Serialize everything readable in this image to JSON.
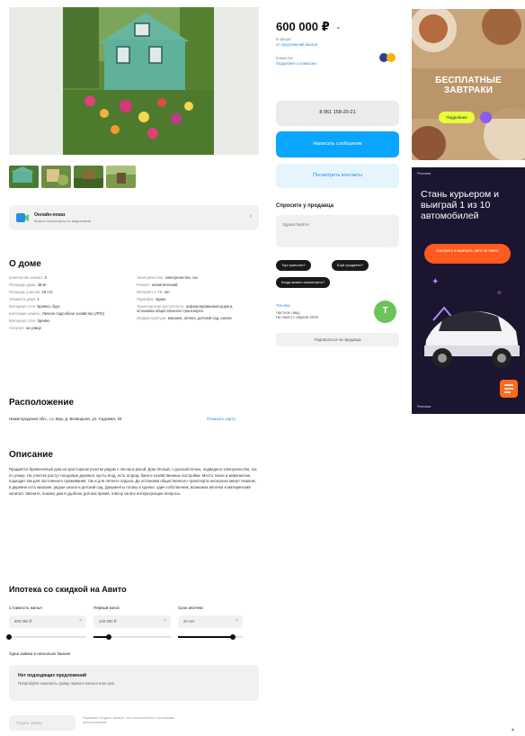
{
  "listing": {
    "price": "600 000 ₽",
    "price_chevron": "⌄",
    "price_history": "В кредит",
    "price_link": "от предложений банков",
    "payment_title": "Комиссия",
    "payment_link": "Подробнее о комиссии"
  },
  "contacts": {
    "phone": "8 961 158-20-21",
    "write_label": "Написать сообщение",
    "show_label": "Посмотреть контакты"
  },
  "delivery": {
    "title": "Онлайн-показ",
    "subtitle": "Можно посмотреть по видеосвязи",
    "chevron": "›"
  },
  "sections": {
    "about_house": "О доме",
    "location": "Расположение",
    "description": "Описание",
    "mortgage": "Ипотека со скидкой на Авито"
  },
  "params_left": [
    {
      "k": "Количество комнат: ",
      "v": "3"
    },
    {
      "k": "Площадь дома: ",
      "v": "48 м²"
    },
    {
      "k": "Площадь участка: ",
      "v": "15 сот."
    },
    {
      "k": "Этажей в доме: ",
      "v": "1"
    },
    {
      "k": "Материал стен: ",
      "v": "Бревно, брус"
    },
    {
      "k": "Категория земель: ",
      "v": "Личное подсобное хозяйство (ЛПХ)"
    },
    {
      "k": "Материал стен: ",
      "v": "бревно"
    },
    {
      "k": "Санузел: ",
      "v": "на улице"
    }
  ],
  "params_right": [
    {
      "k": "Электричество: ",
      "v": "электричество, газ"
    },
    {
      "k": "Ремонт: ",
      "v": "косметический"
    },
    {
      "k": "Интернет и ТВ: ",
      "v": "нет"
    },
    {
      "k": "Парковка: ",
      "v": "гараж"
    },
    {
      "k": "Транспортная доступность: ",
      "v": "асфальтированная дорога, остановка общественного транспорта"
    },
    {
      "k": "Инфраструктура: ",
      "v": "магазин, аптека, детский сад, школа"
    }
  ],
  "location": {
    "address": "Нижегородская обл., г.о. Бор, д. Безводное, ул. Садовая, 20",
    "map_link": "Показать карту"
  },
  "description": {
    "text": "Продаётся бревенчатый дом на просторном участке рядом с лесом и рекой. Дом тёплый, с русской печью, подведено электричество, газ по улице. На участке растут плодовые деревья, кусты ягод, есть огород, баня и хозяйственные постройки. Место тихое и живописное, подходит как для постоянного проживания, так и для летнего отдыха. До остановки общественного транспорта несколько минут пешком, в деревне есть магазин, рядом школа и детский сад. Документы готовы к сделке, один собственник, возможна ипотека и материнский капитал. Звоните, покажу дом в удобное для вас время, отвечу на все интересующие вопросы."
  },
  "mortgage": {
    "cost_label": "Стоимость жилья",
    "cost_value": "600 000 ₽",
    "down_label": "Первый взнос",
    "down_value": "120 000 ₽",
    "term_label": "Срок ипотеки",
    "term_value": "20 лет",
    "clear": "×",
    "cost_fill": 0.0,
    "down_fill": 0.2,
    "term_fill": 0.85,
    "banks_label": "Одна заявка в несколько банков",
    "offer_title": "Нет подходящих предложений",
    "offer_sub": "Попробуйте изменить сумму первого взноса или срок",
    "submit_label": "Подать заявку",
    "footnote": "Нажимая «Подать заявку», вы соглашаетесь с условиями использования"
  },
  "ask": {
    "title": "Спросите у продавца",
    "placeholder": "Здравствуйте!",
    "chips": [
      "Торг уместен?",
      "Ещё продаёте?",
      "Когда можно посмотреть?"
    ]
  },
  "seller": {
    "name": "Татьяна",
    "type": "Частное лицо",
    "since": "На Авито с апреля 2016",
    "avatar_letter": "Т",
    "subscribe_label": "Подписаться на продавца"
  },
  "ads": {
    "ad1_title": "БЕСПЛАТНЫЕ ЗАВТРАКИ",
    "ad1_button": "Подробнее",
    "ad2_tag": "Реклама",
    "ad2_title": "Стань курьером и выиграй 1 из 10 автомобилей",
    "ad2_button": "Смотреть и выиграть авто на Авито",
    "ad2_footer": "Реклама"
  },
  "colors": {
    "accent": "#0aa5ff",
    "link": "#2c8de0",
    "avatar": "#6cc35a",
    "ad2_bg": "#1b1530",
    "ad2_btn": "#ff5a1f"
  }
}
